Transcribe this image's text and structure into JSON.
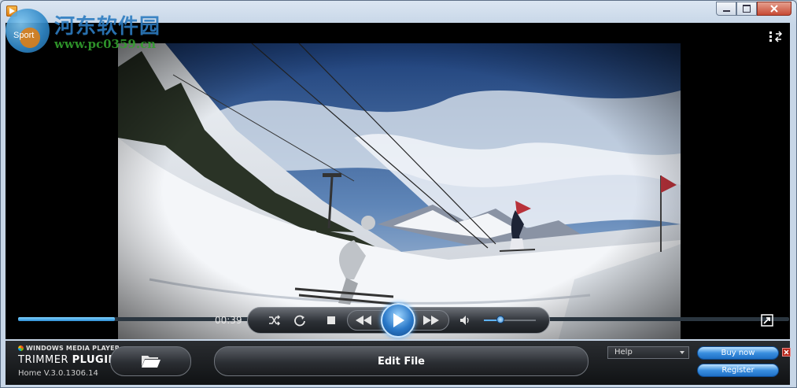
{
  "window": {
    "app_icon": "media-player-app-icon",
    "buttons": [
      "minimize-icon",
      "restore-icon",
      "close-icon"
    ]
  },
  "watermark": {
    "corner_label": "Sport",
    "site_name": "河东软件园",
    "site_url": "www.pc0359.cn"
  },
  "player": {
    "current_time": "00:39",
    "seek_progress": 0.126,
    "volume_level": 0.32,
    "controls": {
      "shuffle_icon": "shuffle-icon",
      "repeat_icon": "repeat-icon",
      "stop_icon": "stop-icon",
      "rewind_icon": "rewind-icon",
      "play_icon": "play-icon",
      "fast_forward_icon": "fast-forward-icon",
      "volume_icon": "speaker-icon"
    },
    "top_right_icon": "switch-to-library-icon",
    "bottom_right_icon": "switch-to-compact-icon"
  },
  "plugin": {
    "brand_small": "WINDOWS MEDIA PLAYER",
    "brand_title_plain": "TRIMMER",
    "brand_title_bold": "PLUGIN",
    "version": "Home V.3.0.1306.14",
    "open_button_icon": "folder-icon",
    "edit_button": "Edit File",
    "help_select": "Help",
    "buy_button": "Buy now",
    "register_button": "Register",
    "close_icon": "close-icon"
  },
  "colors": {
    "accent_blue": "#2f86d4",
    "panel_dark": "#1b1e22",
    "watermark_blue": "#2d7cc0",
    "watermark_green": "#32a02e"
  }
}
